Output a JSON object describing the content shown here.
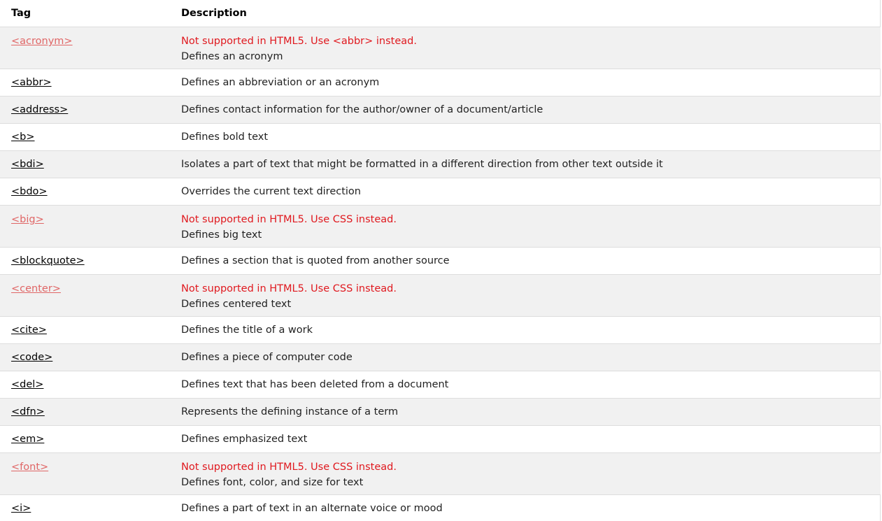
{
  "header": {
    "tag": "Tag",
    "description": "Description"
  },
  "rows": [
    {
      "tag": "<acronym>",
      "deprecated": true,
      "warning": "Not supported in HTML5. Use <abbr> instead.",
      "description": "Defines an acronym"
    },
    {
      "tag": "<abbr>",
      "deprecated": false,
      "warning": "",
      "description": "Defines an abbreviation or an acronym"
    },
    {
      "tag": "<address>",
      "deprecated": false,
      "warning": "",
      "description": "Defines contact information for the author/owner of a document/article"
    },
    {
      "tag": "<b>",
      "deprecated": false,
      "warning": "",
      "description": "Defines bold text"
    },
    {
      "tag": "<bdi>",
      "deprecated": false,
      "warning": "",
      "description": "Isolates a part of text that might be formatted in a different direction from other text outside it"
    },
    {
      "tag": "<bdo>",
      "deprecated": false,
      "warning": "",
      "description": "Overrides the current text direction"
    },
    {
      "tag": "<big>",
      "deprecated": true,
      "warning": "Not supported in HTML5. Use CSS instead.",
      "description": "Defines big text"
    },
    {
      "tag": "<blockquote>",
      "deprecated": false,
      "warning": "",
      "description": "Defines a section that is quoted from another source"
    },
    {
      "tag": "<center>",
      "deprecated": true,
      "warning": "Not supported in HTML5. Use CSS instead.",
      "description": "Defines centered text"
    },
    {
      "tag": "<cite>",
      "deprecated": false,
      "warning": "",
      "description": "Defines the title of a work"
    },
    {
      "tag": "<code>",
      "deprecated": false,
      "warning": "",
      "description": "Defines a piece of computer code"
    },
    {
      "tag": "<del>",
      "deprecated": false,
      "warning": "",
      "description": "Defines text that has been deleted from a document"
    },
    {
      "tag": "<dfn>",
      "deprecated": false,
      "warning": "",
      "description": "Represents the defining instance of a term"
    },
    {
      "tag": "<em>",
      "deprecated": false,
      "warning": "",
      "description": "Defines emphasized text"
    },
    {
      "tag": "<font>",
      "deprecated": true,
      "warning": "Not supported in HTML5. Use CSS instead.",
      "description": "Defines font, color, and size for text"
    },
    {
      "tag": "<i>",
      "deprecated": false,
      "warning": "",
      "description": "Defines a part of text in an alternate voice or mood"
    }
  ],
  "colors": {
    "row_shade": "#f1f1f1",
    "border": "#dddddd",
    "warning_text": "#e0191f",
    "deprecated_link": "#e06666"
  }
}
